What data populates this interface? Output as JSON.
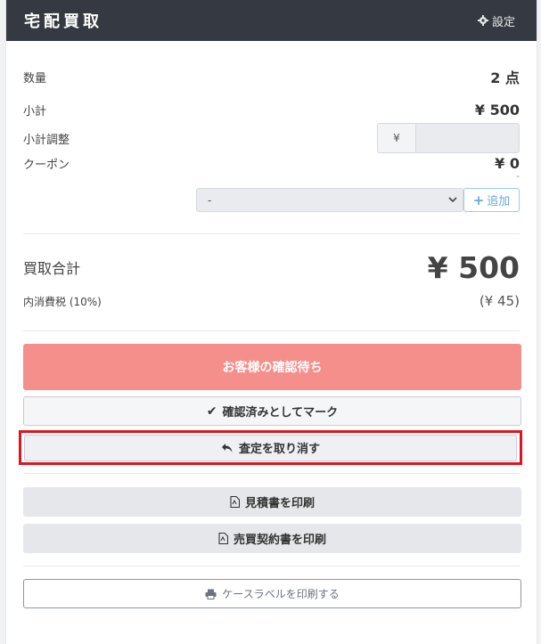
{
  "header": {
    "title": "宅配買取",
    "settings_label": "設定"
  },
  "summary": {
    "quantity_label": "数量",
    "quantity_value": "2 点",
    "subtotal_label": "小計",
    "subtotal_value": "¥ 500",
    "adjust_label": "小計調整",
    "adjust_prefix": "¥",
    "adjust_value": "",
    "coupon_label": "クーポン",
    "coupon_value": "¥ 0",
    "coupon_note": "-",
    "coupon_select_value": "-",
    "coupon_add_label": "追加"
  },
  "total": {
    "label": "買取合計",
    "value": "¥ 500",
    "tax_label": "内消費税 (10%)",
    "tax_value": "(¥ 45)"
  },
  "actions": {
    "status_label": "お客様の確認待ち",
    "mark_confirmed_label": "確認済みとしてマーク",
    "cancel_assessment_label": "査定を取り消す",
    "print_estimate_label": "見積書を印刷",
    "print_contract_label": "売買契約書を印刷",
    "print_case_label_label": "ケースラベルを印刷する"
  },
  "colors": {
    "header_bg": "#353a42",
    "status_bg": "#f48f8b",
    "highlight_border": "#e0141e"
  }
}
